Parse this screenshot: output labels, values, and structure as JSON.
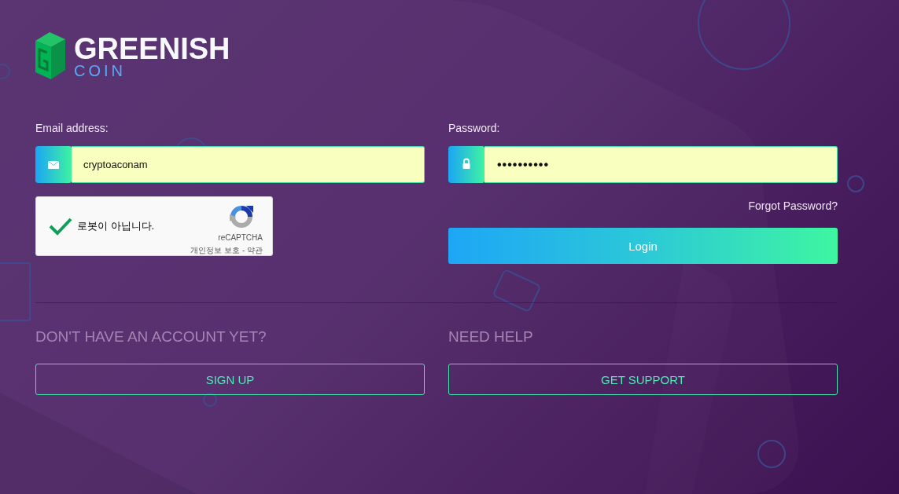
{
  "logo": {
    "name": "GREENISH",
    "subtitle": "COIN"
  },
  "email": {
    "label": "Email address:",
    "value": "cryptoaconam"
  },
  "password": {
    "label": "Password:",
    "value": "••••••••••"
  },
  "captcha": {
    "checked": true,
    "label": "로봇이 아닙니다.",
    "brand": "reCAPTCHA",
    "links": "개인정보 보호 - 약관"
  },
  "forgot_link": "Forgot Password?",
  "login_button": "Login",
  "sections": [
    {
      "heading": "DON'T HAVE AN ACCOUNT YET?",
      "button": "SIGN UP"
    },
    {
      "heading": "NEED HELP",
      "button": "GET SUPPORT"
    }
  ]
}
